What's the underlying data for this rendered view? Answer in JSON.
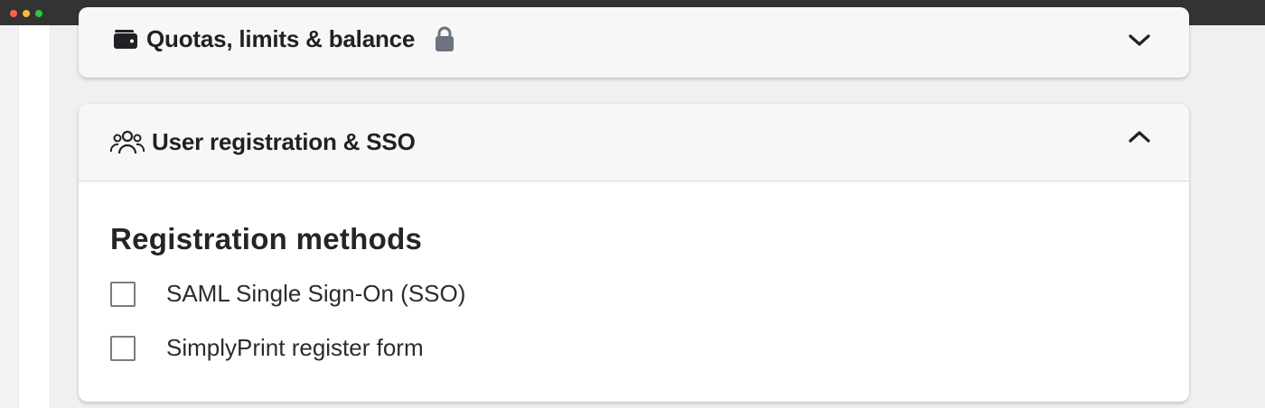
{
  "window": {
    "controls": [
      "close",
      "minimize",
      "maximize"
    ]
  },
  "quota_panel": {
    "title": "Quotas, limits & balance",
    "icon": "wallet-icon",
    "lock_icon": "lock-icon",
    "expanded": false,
    "toggle_icon": "chevron-down-icon"
  },
  "sso_panel": {
    "title": "User registration & SSO",
    "icon": "users-icon",
    "expanded": true,
    "toggle_icon": "chevron-up-icon",
    "section_title": "Registration methods",
    "options": [
      {
        "label": "SAML Single Sign-On (SSO)",
        "checked": false
      },
      {
        "label": "SimplyPrint register form",
        "checked": false
      }
    ]
  },
  "colors": {
    "titlebar": "#333333",
    "card_header_bg": "#f7f7f7",
    "card_body_bg": "#ffffff",
    "text": "#1f2124",
    "lock_gray": "#6c737f"
  }
}
